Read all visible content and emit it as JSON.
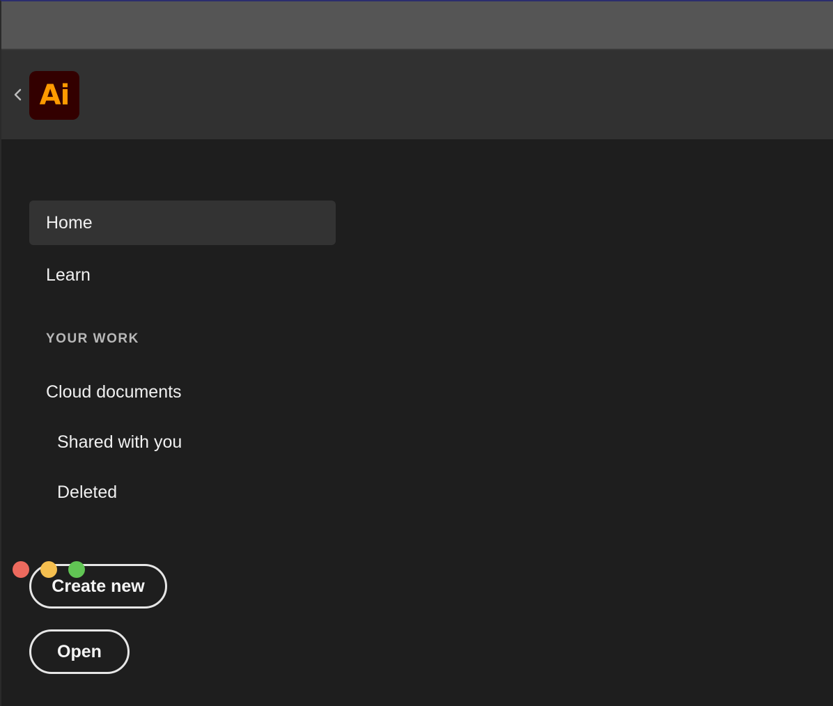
{
  "app": {
    "logo_text": "Ai",
    "logo_color": "#ff9a00",
    "logo_bg": "#330000"
  },
  "appbar": {
    "back_icon": "chevron-left-icon"
  },
  "sidebar": {
    "items": [
      {
        "label": "Home",
        "selected": true
      },
      {
        "label": "Learn",
        "selected": false
      }
    ],
    "section_heading": "YOUR WORK",
    "work_items": [
      {
        "label": "Cloud documents"
      },
      {
        "label": "Shared with you"
      },
      {
        "label": "Deleted"
      }
    ]
  },
  "actions": {
    "create_new_label": "Create new",
    "open_label": "Open"
  },
  "window_controls": {
    "close_color": "#ed6a5e",
    "minimize_color": "#f5bf4f",
    "zoom_color": "#61c554"
  }
}
